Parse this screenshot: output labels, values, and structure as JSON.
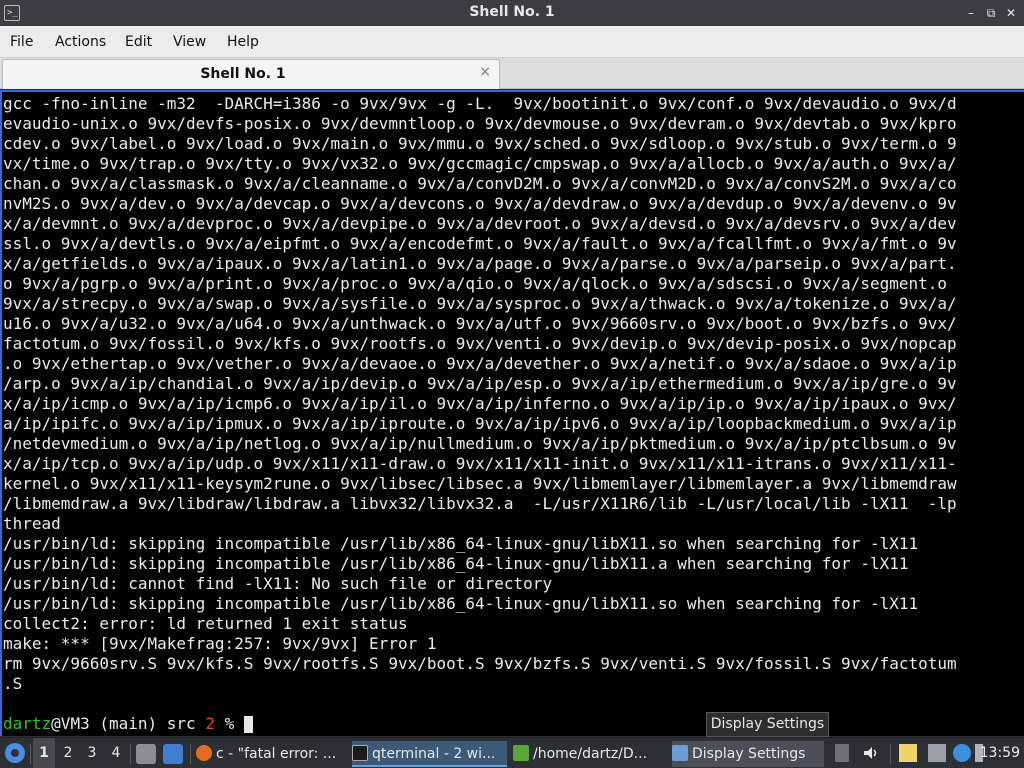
{
  "window": {
    "title": "Shell No. 1",
    "app_icon": ">_",
    "minimize_glyph": "–",
    "maximize_glyph": "⧉",
    "close_glyph": "✕"
  },
  "menu": {
    "items": [
      "File",
      "Actions",
      "Edit",
      "View",
      "Help"
    ]
  },
  "tab": {
    "label": "Shell No. 1",
    "close_glyph": "×"
  },
  "terminal": {
    "lines": [
      "gcc -fno-inline -m32  -DARCH=i386 -o 9vx/9vx -g -L.  9vx/bootinit.o 9vx/conf.o 9vx/devaudio.o 9vx/d",
      "evaudio-unix.o 9vx/devfs-posix.o 9vx/devmntloop.o 9vx/devmouse.o 9vx/devram.o 9vx/devtab.o 9vx/kpro",
      "cdev.o 9vx/label.o 9vx/load.o 9vx/main.o 9vx/mmu.o 9vx/sched.o 9vx/sdloop.o 9vx/stub.o 9vx/term.o 9",
      "vx/time.o 9vx/trap.o 9vx/tty.o 9vx/vx32.o 9vx/gccmagic/cmpswap.o 9vx/a/allocb.o 9vx/a/auth.o 9vx/a/",
      "chan.o 9vx/a/classmask.o 9vx/a/cleanname.o 9vx/a/convD2M.o 9vx/a/convM2D.o 9vx/a/convS2M.o 9vx/a/co",
      "nvM2S.o 9vx/a/dev.o 9vx/a/devcap.o 9vx/a/devcons.o 9vx/a/devdraw.o 9vx/a/devdup.o 9vx/a/devenv.o 9v",
      "x/a/devmnt.o 9vx/a/devproc.o 9vx/a/devpipe.o 9vx/a/devroot.o 9vx/a/devsd.o 9vx/a/devsrv.o 9vx/a/dev",
      "ssl.o 9vx/a/devtls.o 9vx/a/eipfmt.o 9vx/a/encodefmt.o 9vx/a/fault.o 9vx/a/fcallfmt.o 9vx/a/fmt.o 9v",
      "x/a/getfields.o 9vx/a/ipaux.o 9vx/a/latin1.o 9vx/a/page.o 9vx/a/parse.o 9vx/a/parseip.o 9vx/a/part.",
      "o 9vx/a/pgrp.o 9vx/a/print.o 9vx/a/proc.o 9vx/a/qio.o 9vx/a/qlock.o 9vx/a/sdscsi.o 9vx/a/segment.o ",
      "9vx/a/strecpy.o 9vx/a/swap.o 9vx/a/sysfile.o 9vx/a/sysproc.o 9vx/a/thwack.o 9vx/a/tokenize.o 9vx/a/",
      "u16.o 9vx/a/u32.o 9vx/a/u64.o 9vx/a/unthwack.o 9vx/a/utf.o 9vx/9660srv.o 9vx/boot.o 9vx/bzfs.o 9vx/",
      "factotum.o 9vx/fossil.o 9vx/kfs.o 9vx/rootfs.o 9vx/venti.o 9vx/devip.o 9vx/devip-posix.o 9vx/nopcap",
      ".o 9vx/ethertap.o 9vx/vether.o 9vx/a/devaoe.o 9vx/a/devether.o 9vx/a/netif.o 9vx/a/sdaoe.o 9vx/a/ip",
      "/arp.o 9vx/a/ip/chandial.o 9vx/a/ip/devip.o 9vx/a/ip/esp.o 9vx/a/ip/ethermedium.o 9vx/a/ip/gre.o 9v",
      "x/a/ip/icmp.o 9vx/a/ip/icmp6.o 9vx/a/ip/il.o 9vx/a/ip/inferno.o 9vx/a/ip/ip.o 9vx/a/ip/ipaux.o 9vx/",
      "a/ip/ipifc.o 9vx/a/ip/ipmux.o 9vx/a/ip/iproute.o 9vx/a/ip/ipv6.o 9vx/a/ip/loopbackmedium.o 9vx/a/ip",
      "/netdevmedium.o 9vx/a/ip/netlog.o 9vx/a/ip/nullmedium.o 9vx/a/ip/pktmedium.o 9vx/a/ip/ptclbsum.o 9v",
      "x/a/ip/tcp.o 9vx/a/ip/udp.o 9vx/x11/x11-draw.o 9vx/x11/x11-init.o 9vx/x11/x11-itrans.o 9vx/x11/x11-",
      "kernel.o 9vx/x11/x11-keysym2rune.o 9vx/libsec/libsec.a 9vx/libmemlayer/libmemlayer.a 9vx/libmemdraw",
      "/libmemdraw.a 9vx/libdraw/libdraw.a libvx32/libvx32.a  -L/usr/X11R6/lib -L/usr/local/lib -lX11  -lp",
      "thread",
      "/usr/bin/ld: skipping incompatible /usr/lib/x86_64-linux-gnu/libX11.so when searching for -lX11",
      "/usr/bin/ld: skipping incompatible /usr/lib/x86_64-linux-gnu/libX11.a when searching for -lX11",
      "/usr/bin/ld: cannot find -lX11: No such file or directory",
      "/usr/bin/ld: skipping incompatible /usr/lib/x86_64-linux-gnu/libX11.so when searching for -lX11",
      "collect2: error: ld returned 1 exit status",
      "make: *** [9vx/Makefrag:257: 9vx/9vx] Error 1",
      "rm 9vx/9660srv.S 9vx/kfs.S 9vx/rootfs.S 9vx/boot.S 9vx/bzfs.S 9vx/venti.S 9vx/fossil.S 9vx/factotum",
      ".S"
    ],
    "prompt": {
      "user": "dartz",
      "rest": "@VM3 (main) src ",
      "exit_code": "2",
      "symbol": " % "
    }
  },
  "tooltip": {
    "text": "Display Settings"
  },
  "taskbar": {
    "workspaces": [
      "1",
      "2",
      "3",
      "4"
    ],
    "active_workspace": "1",
    "tasks": [
      {
        "label": "c - \"fatal error: ...",
        "icon": "firefox-icon"
      },
      {
        "label": "qterminal - 2 wi...",
        "icon": "terminal-icon"
      },
      {
        "label": "/home/dartz/D...",
        "icon": "file-manager-icon"
      },
      {
        "label": "Display Settings",
        "icon": "display-icon"
      }
    ],
    "clock": "13:59"
  },
  "colors": {
    "prompt_user": "#2ec42e",
    "prompt_exit_code": "#e04545",
    "terminal_bg": "#000000",
    "focus_border": "#2b6ce0"
  }
}
